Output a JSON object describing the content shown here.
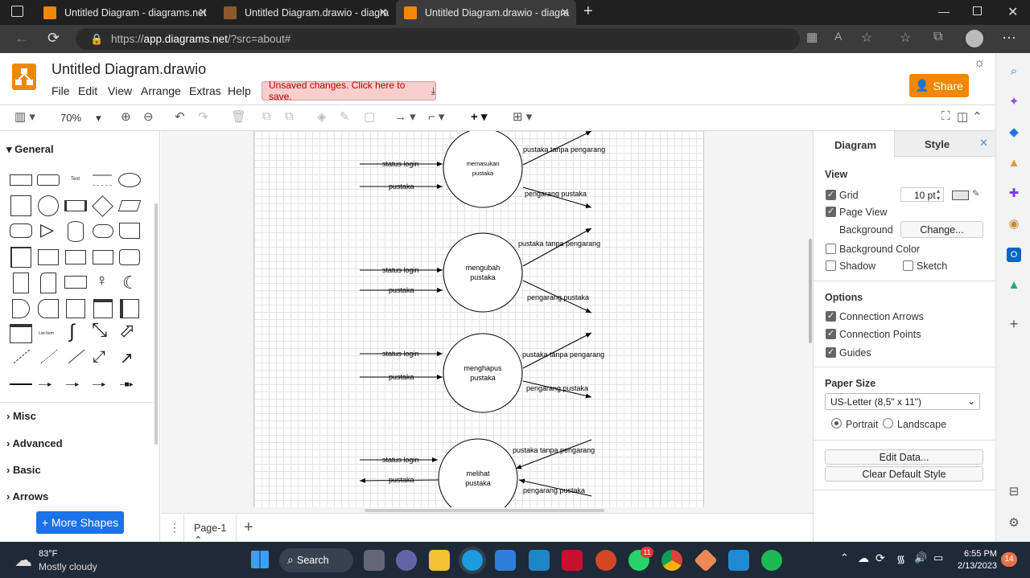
{
  "browser": {
    "tabs": [
      {
        "label": "Untitled Diagram - diagrams.net"
      },
      {
        "label": "Untitled Diagram.drawio - diagra"
      },
      {
        "label": "Untitled Diagram.drawio - diagra"
      }
    ],
    "new_tab": "+",
    "url_prefix": "https://",
    "url_host": "app.diagrams.net",
    "url_rest": "/?src=about#"
  },
  "app": {
    "title": "Untitled Diagram.drawio",
    "menu": [
      "File",
      "Edit",
      "View",
      "Arrange",
      "Extras",
      "Help"
    ],
    "unsaved": "Unsaved changes. Click here to save.",
    "share": "Share",
    "zoom": "70%"
  },
  "left_panel": {
    "sections": [
      "General",
      "Misc",
      "Advanced",
      "Basic",
      "Arrows"
    ],
    "more_shapes": "+ More Shapes"
  },
  "diagram": {
    "processes": [
      {
        "label": "memasukan pustaka",
        "in1": "status login",
        "in2": "pustaka",
        "out1": "pustaka tanpa pengarang",
        "out2": "pengarang pustaka"
      },
      {
        "label": "mengubah pustaka",
        "in1": "status login",
        "in2": "pustaka",
        "out1": "pustaka tanpa pengarang",
        "out2": "pengarang pustaka"
      },
      {
        "label": "menghapus pustaka",
        "in1": "status login",
        "in2": "pustaka",
        "out1": "pustaka tanpa pengarang",
        "out2": "pengarang pustaka"
      },
      {
        "label": "melihat pustaka",
        "in1": "status login",
        "in2": "pustaka",
        "out1": "pustaka tanpa pengarang",
        "out2": "pengarang pustaka"
      }
    ]
  },
  "page_tab": "Page-1",
  "right_panel": {
    "tabs": [
      "Diagram",
      "Style"
    ],
    "view_title": "View",
    "grid": "Grid",
    "grid_size": "10 pt",
    "page_view": "Page View",
    "background": "Background",
    "change": "Change...",
    "background_color": "Background Color",
    "shadow": "Shadow",
    "sketch": "Sketch",
    "options_title": "Options",
    "connection_arrows": "Connection Arrows",
    "connection_points": "Connection Points",
    "guides": "Guides",
    "paper_size_title": "Paper Size",
    "paper_size": "US-Letter (8,5\" x 11\")",
    "portrait": "Portrait",
    "landscape": "Landscape",
    "edit_data": "Edit Data...",
    "clear_style": "Clear Default Style"
  },
  "taskbar": {
    "temp": "83°F",
    "weather": "Mostly cloudy",
    "search": "Search",
    "time": "6:55 PM",
    "date": "2/13/2023",
    "notif_count": "14",
    "whatsapp_badge": "11"
  },
  "colors": {
    "accent": "#f08705",
    "link_blue": "#1a73e8",
    "unsaved_bg": "#f8cecc"
  }
}
